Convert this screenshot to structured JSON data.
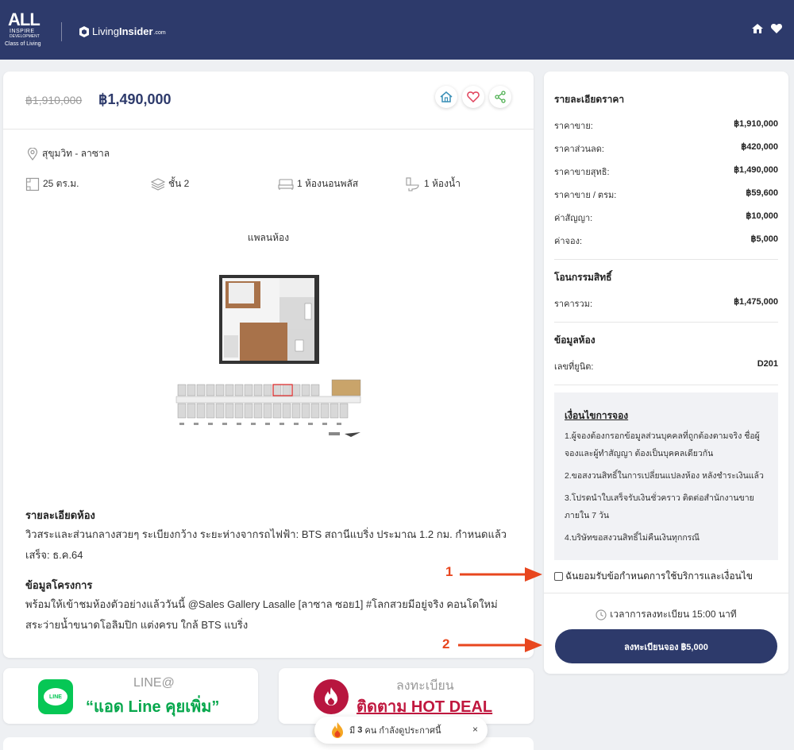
{
  "header": {
    "brand_all": "ALL",
    "brand_line1": "INSPIRE",
    "brand_line2": "DEVELOPMENT",
    "brand_tagline": "Class of Living",
    "partner_prefix": "Living",
    "partner_bold": "Insider",
    "partner_suffix": ".com",
    "icons": [
      "home-icon",
      "heart-icon"
    ]
  },
  "listing": {
    "price_original": "฿1,910,000",
    "price_current": "฿1,490,000",
    "actions": [
      "home-icon",
      "heart-icon",
      "share-icon"
    ],
    "location": "สุขุมวิท - ลาซาล",
    "specs": {
      "area": "25 ตร.ม.",
      "floor": "ชั้น 2",
      "bedroom": "1 ห้องนอนพลัส",
      "bathroom": "1 ห้องน้ำ"
    },
    "plan_title": "แพลนห้อง",
    "detail_heading": "รายละเอียดห้อง",
    "detail_text": "วิวสระและส่วนกลางสวยๆ ระเบียงกว้าง ระยะห่างจากรถไฟฟ้า: BTS สถานีแบริ่ง ประมาณ 1.2 กม. กำหนดแล้วเสร็จ: ธ.ค.64",
    "project_heading": "ข้อมูลโครงการ",
    "project_text": "พร้อมให้เข้าชมห้องตัวอย่างแล้ววันนี้ @Sales Gallery Lasalle [ลาซาล ซอย1] #โลกสวยมีอยู่จริง คอนโดใหม่ สระว่ายน้ำขนาดโอลิมปิก แต่งครบ ใกล้ BTS แบริ่ง"
  },
  "sidebar": {
    "price_section_title": "รายละเอียดราคา",
    "price_rows": [
      {
        "label": "ราคาขาย:",
        "value": "฿1,910,000"
      },
      {
        "label": "ราคาส่วนลด:",
        "value": "฿420,000"
      },
      {
        "label": "ราคาขายสุทธิ:",
        "value": "฿1,490,000"
      },
      {
        "label": "ราคาขาย / ตรม:",
        "value": "฿59,600"
      },
      {
        "label": "ค่าสัญญา:",
        "value": "฿10,000"
      },
      {
        "label": "ค่าจอง:",
        "value": "฿5,000"
      }
    ],
    "transfer_title": "โอนกรรมสิทธิ์",
    "transfer_rows": [
      {
        "label": "ราคารวม:",
        "value": "฿1,475,000"
      }
    ],
    "room_title": "ข้อมูลห้อง",
    "room_rows": [
      {
        "label": "เลขที่ยูนิต:",
        "value": "D201"
      }
    ],
    "conditions_title": "เงื่อนไขการจอง",
    "conditions": [
      "1.ผู้จองต้องกรอกข้อมูลส่วนบุคคลที่ถูกต้องตามจริง ชื่อผู้จองและผู้ทำสัญญา ต้องเป็นบุคคลเดียวกัน",
      "2.ขอสงวนสิทธิ์ในการเปลี่ยนแปลงห้อง หลังชำระเงินแล้ว",
      "3.โปรดนำใบเสร็จรับเงินชั่วคราว ติดต่อสำนักงานขายภายใน 7 วัน",
      "4.บริษัทขอสงวนสิทธิ์ไม่คืนเงินทุกกรณี"
    ],
    "agree_label": "ฉันยอมรับข้อกำหนดการใช้บริการและเงื่อนไข",
    "agree_checked": false,
    "time_text": "เวลาการลงทะเบียน 15:00 นาที",
    "book_button": "ลงทะเบียนจอง ฿5,000"
  },
  "annotations": {
    "marker_1": "1",
    "marker_2": "2",
    "color": "#e8461e"
  },
  "banners": {
    "line_logo": "LINE",
    "line_top": "LINE@",
    "line_main": "“แอด Line คุยเพิ่ม”",
    "reg_top": "ลงทะเบียน",
    "reg_main": "ติดตาม HOT DEAL"
  },
  "toast": {
    "prefix": "มี",
    "count": "3",
    "suffix": "คน กำลังดูประกาศนี้",
    "close": "×"
  },
  "colors": {
    "brand_navy": "#2d3a6b",
    "line_green": "#06c755",
    "hotdeal_red": "#c0183f"
  }
}
